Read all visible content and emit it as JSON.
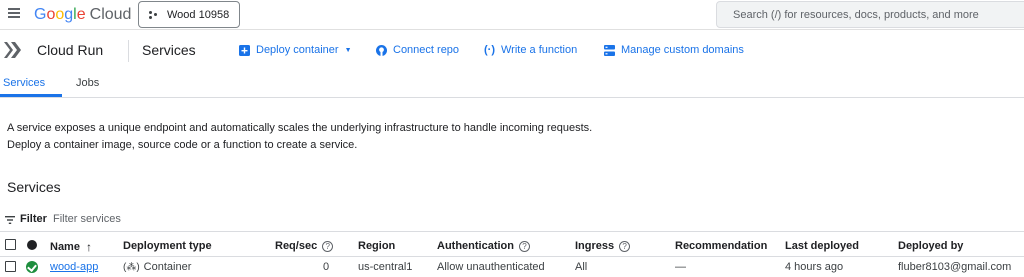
{
  "topbar": {
    "logo_google": "Google",
    "logo_cloud": "Cloud",
    "project": "Wood 10958",
    "search_placeholder": "Search (/) for resources, docs, products, and more"
  },
  "subbar": {
    "product": "Cloud Run",
    "page": "Services",
    "actions": {
      "deploy": "Deploy container",
      "connect": "Connect repo",
      "function": "Write a function",
      "domains": "Manage custom domains"
    }
  },
  "tabs": {
    "services": "Services",
    "jobs": "Jobs"
  },
  "description": {
    "line1": "A service exposes a unique endpoint and automatically scales the underlying infrastructure to handle incoming requests.",
    "line2": "Deploy a container image, source code or a function to create a service."
  },
  "section_title": "Services",
  "filter": {
    "label": "Filter",
    "placeholder": "Filter services"
  },
  "table": {
    "headers": {
      "name": "Name",
      "deployment_type": "Deployment type",
      "req_sec": "Req/sec",
      "region": "Region",
      "authentication": "Authentication",
      "ingress": "Ingress",
      "recommendation": "Recommendation",
      "last_deployed": "Last deployed",
      "deployed_by": "Deployed by"
    },
    "rows": [
      {
        "name": "wood-app",
        "deployment_type": "Container",
        "req_sec": "0",
        "region": "us-central1",
        "authentication": "Allow unauthenticated",
        "ingress": "All",
        "recommendation": "—",
        "last_deployed": "4 hours ago",
        "deployed_by": "fluber8103@gmail.com"
      }
    ]
  },
  "colors": {
    "accent": "#1a73e8",
    "success": "#1e8e3e"
  }
}
